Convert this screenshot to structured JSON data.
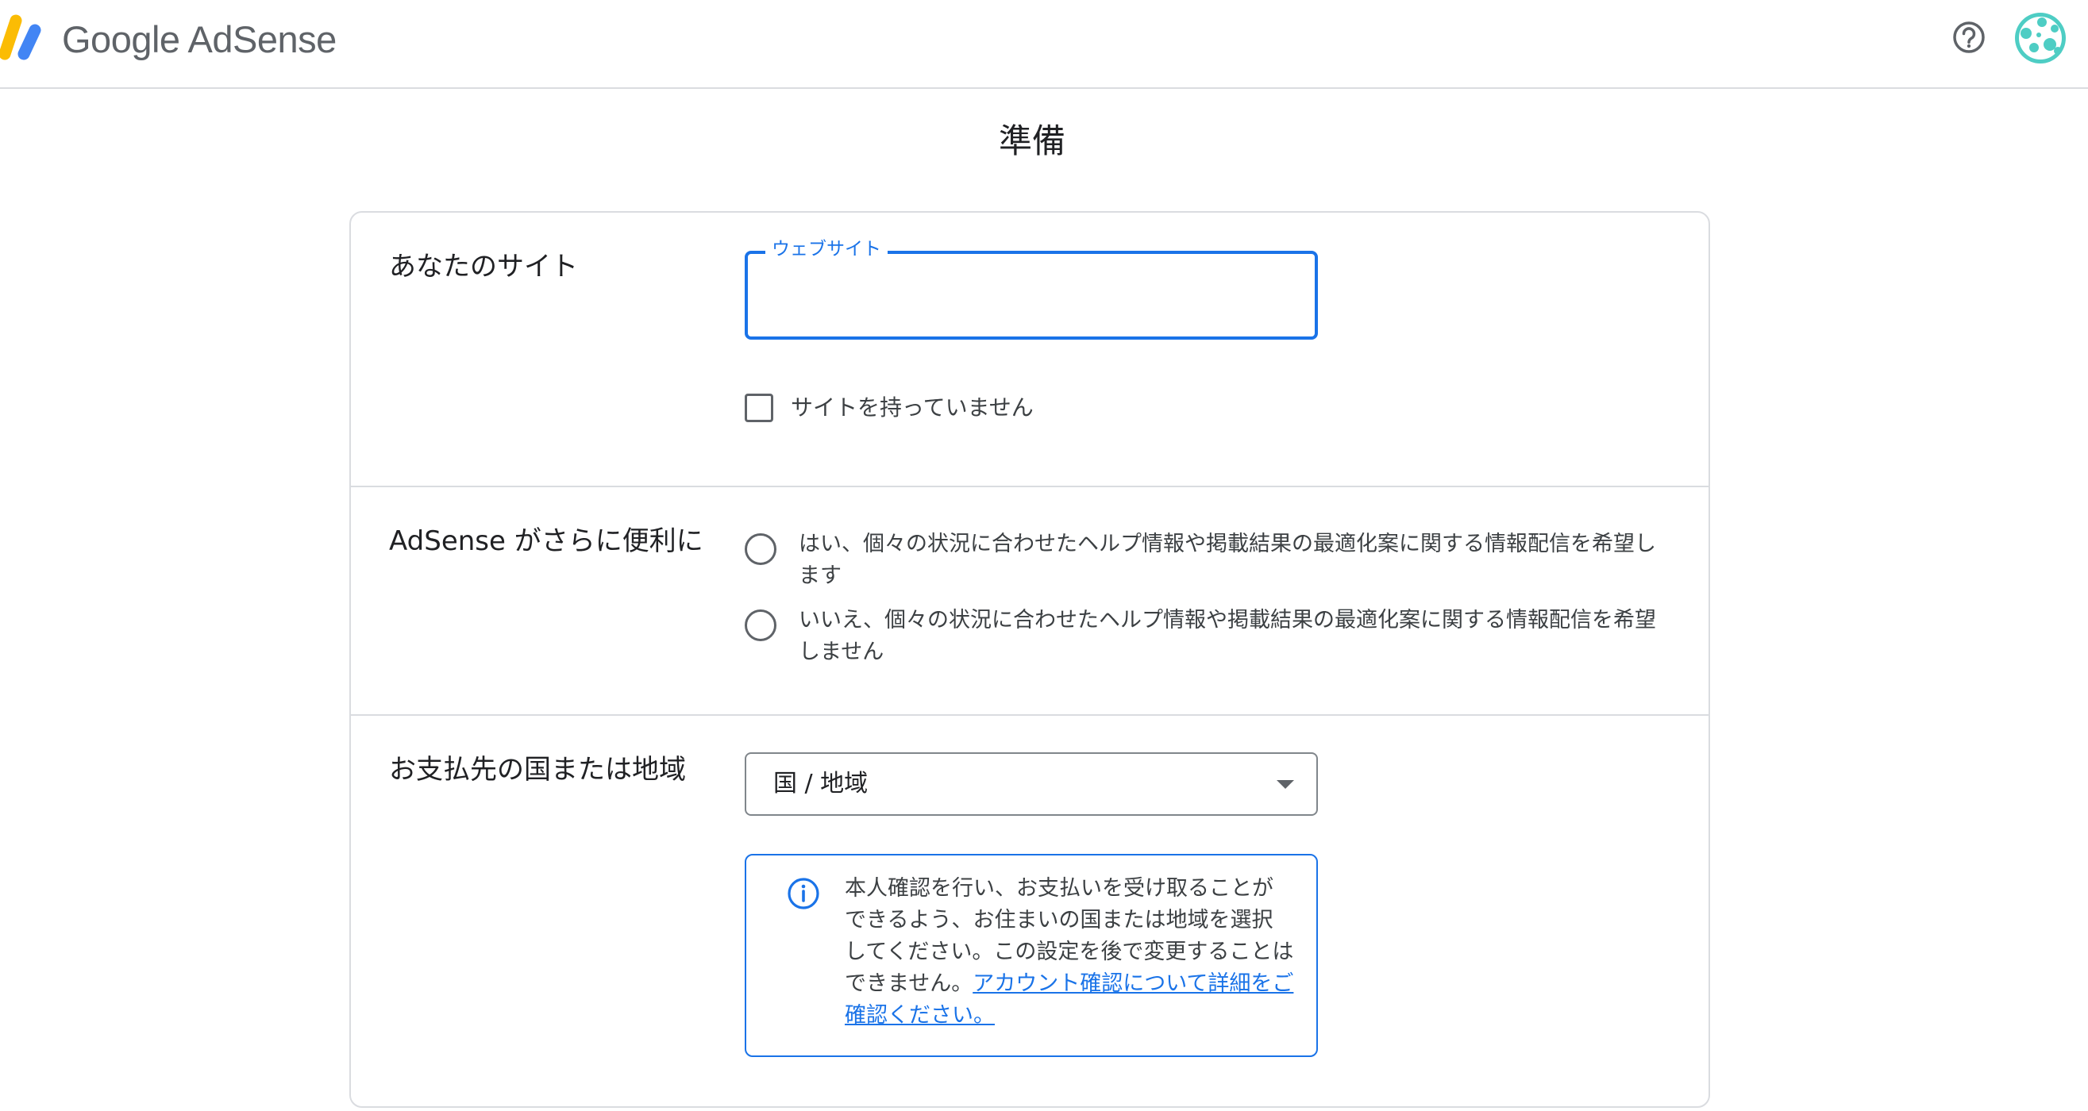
{
  "header": {
    "brand": "Google AdSense",
    "help_icon": "help-circle-icon",
    "avatar_icon": "user-avatar"
  },
  "page": {
    "title": "準備"
  },
  "site_section": {
    "label": "あなたのサイト",
    "website_field": {
      "label": "ウェブサイト",
      "value": "",
      "focused": true
    },
    "no_site_checkbox": {
      "label": "サイトを持っていません",
      "checked": false
    }
  },
  "adsense_section": {
    "label": "AdSense がさらに便利に",
    "options": [
      {
        "label": "はい、個々の状況に合わせたヘルプ情報や掲載結果の最適化案に関する情報配信を希望します",
        "selected": false
      },
      {
        "label": "いいえ、個々の状況に合わせたヘルプ情報や掲載結果の最適化案に関する情報配信を希望しません",
        "selected": false
      }
    ]
  },
  "country_section": {
    "label": "お支払先の国または地域",
    "select": {
      "value": "国 / 地域"
    },
    "info": {
      "icon": "info-icon",
      "text": "本人確認を行い、お支払いを受け取ることができるよう、お住まいの国または地域を選択してください。この設定を後で変更することはできません。",
      "link": "アカウント確認について詳細をご確認ください。"
    }
  },
  "colors": {
    "accent": "#1a73e8",
    "border": "#dadce0",
    "text": "#202124",
    "secondary_text": "#3c4043",
    "logo_yellow": "#fbbc04",
    "logo_blue": "#4285f4",
    "avatar_teal": "#4ecdc4"
  }
}
